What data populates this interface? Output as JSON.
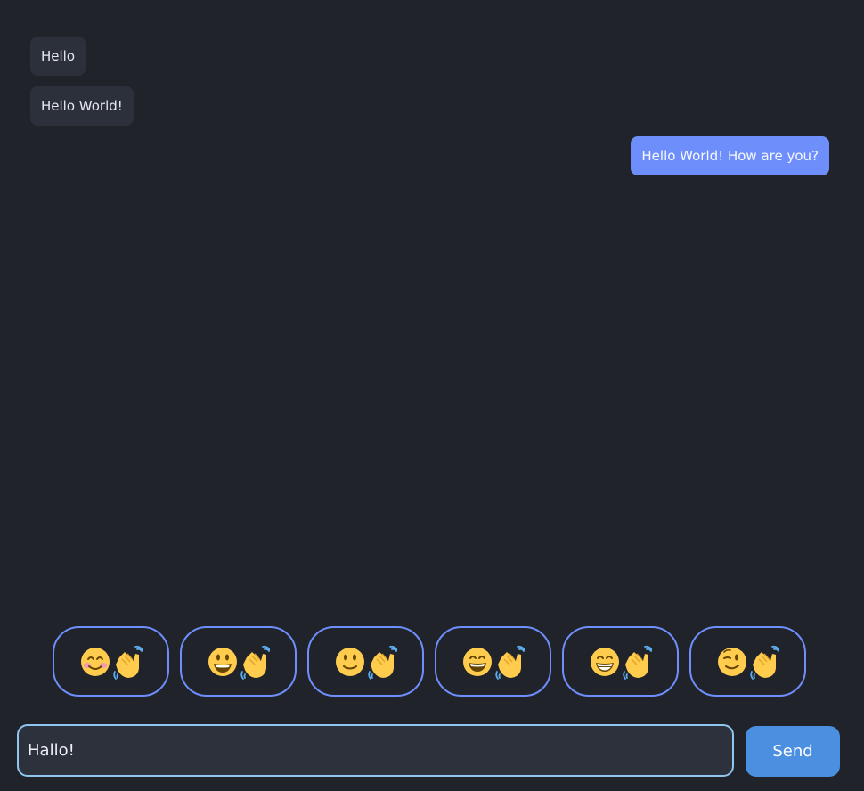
{
  "messages": [
    {
      "text": "Hello",
      "direction": "received"
    },
    {
      "text": "Hello World!",
      "direction": "received"
    },
    {
      "text": "Hello World! How are you?",
      "direction": "sent"
    }
  ],
  "reactions": [
    {
      "face": "smiling-face-with-blush",
      "hand": "waving-hand"
    },
    {
      "face": "grinning-face-with-big-eyes",
      "hand": "waving-hand"
    },
    {
      "face": "slightly-smiling-face",
      "hand": "waving-hand"
    },
    {
      "face": "grinning-face-with-smiling-eyes",
      "hand": "waving-hand"
    },
    {
      "face": "beaming-face-with-smiling-eyes",
      "hand": "waving-hand"
    },
    {
      "face": "winking-face",
      "hand": "waving-hand"
    }
  ],
  "composer": {
    "value": "Hallo!",
    "send_label": "Send"
  },
  "colors": {
    "background": "#21232b",
    "received_bubble": "#2c303a",
    "sent_bubble": "#6e8efb",
    "reaction_border": "#6e8efb",
    "input_border": "#8fc6ee",
    "send_button": "#4a8fe0"
  }
}
